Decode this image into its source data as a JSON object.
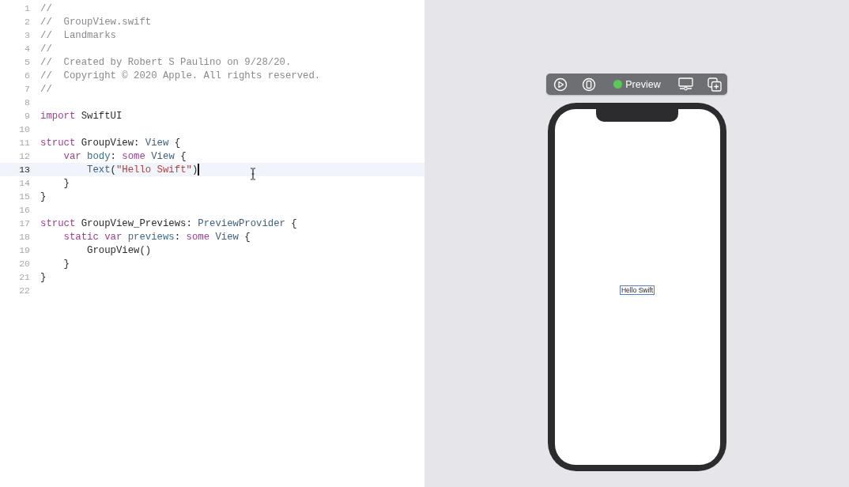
{
  "editor": {
    "lines": [
      {
        "number": "1",
        "selected": false,
        "tokens": [
          {
            "kind": "comment",
            "text": "//"
          }
        ]
      },
      {
        "number": "2",
        "selected": false,
        "tokens": [
          {
            "kind": "comment",
            "text": "//  GroupView.swift"
          }
        ]
      },
      {
        "number": "3",
        "selected": false,
        "tokens": [
          {
            "kind": "comment",
            "text": "//  Landmarks"
          }
        ]
      },
      {
        "number": "4",
        "selected": false,
        "tokens": [
          {
            "kind": "comment",
            "text": "//"
          }
        ]
      },
      {
        "number": "5",
        "selected": false,
        "tokens": [
          {
            "kind": "comment",
            "text": "//  Created by Robert S Paulino on 9/28/20."
          }
        ]
      },
      {
        "number": "6",
        "selected": false,
        "tokens": [
          {
            "kind": "comment",
            "text": "//  Copyright © 2020 Apple. All rights reserved."
          }
        ]
      },
      {
        "number": "7",
        "selected": false,
        "tokens": [
          {
            "kind": "comment",
            "text": "//"
          }
        ]
      },
      {
        "number": "8",
        "selected": false
      },
      {
        "number": "9",
        "selected": false,
        "tokens": [
          {
            "kind": "keyword",
            "text": "import"
          },
          {
            "kind": "plain",
            "text": " SwiftUI"
          }
        ]
      },
      {
        "number": "10",
        "selected": false
      },
      {
        "number": "11",
        "selected": false,
        "tokens": [
          {
            "kind": "keyword",
            "text": "struct"
          },
          {
            "kind": "plain",
            "text": " GroupView: "
          },
          {
            "kind": "type",
            "text": "View"
          },
          {
            "kind": "plain",
            "text": " {"
          }
        ]
      },
      {
        "number": "12",
        "selected": false,
        "tokens": [
          {
            "kind": "keyword",
            "text": "    var"
          },
          {
            "kind": "property",
            "text": " body"
          },
          {
            "kind": "plain",
            "text": ": "
          },
          {
            "kind": "keyword",
            "text": "some"
          },
          {
            "kind": "type",
            "text": " View"
          },
          {
            "kind": "plain",
            "text": " {"
          }
        ]
      },
      {
        "number": "13",
        "selected": true,
        "tokens": [
          {
            "kind": "type",
            "text": "        Text"
          },
          {
            "kind": "plain",
            "text": "("
          },
          {
            "kind": "string",
            "text": "\"Hello Swift\""
          },
          {
            "kind": "plain",
            "text": ")"
          }
        ]
      },
      {
        "number": "14",
        "selected": false,
        "tokens": [
          {
            "kind": "plain",
            "text": "    }"
          }
        ]
      },
      {
        "number": "15",
        "selected": false,
        "tokens": [
          {
            "kind": "plain",
            "text": "}"
          }
        ]
      },
      {
        "number": "16",
        "selected": false
      },
      {
        "number": "17",
        "selected": false,
        "tokens": [
          {
            "kind": "keyword",
            "text": "struct"
          },
          {
            "kind": "plain",
            "text": " GroupView_Previews: "
          },
          {
            "kind": "type",
            "text": "PreviewProvider"
          },
          {
            "kind": "plain",
            "text": " {"
          }
        ]
      },
      {
        "number": "18",
        "selected": false,
        "tokens": [
          {
            "kind": "keyword",
            "text": "    static var"
          },
          {
            "kind": "property",
            "text": " previews"
          },
          {
            "kind": "plain",
            "text": ": "
          },
          {
            "kind": "keyword",
            "text": "some"
          },
          {
            "kind": "type",
            "text": " View"
          },
          {
            "kind": "plain",
            "text": " {"
          }
        ]
      },
      {
        "number": "19",
        "selected": false,
        "tokens": [
          {
            "kind": "plain",
            "text": "        GroupView()"
          }
        ]
      },
      {
        "number": "20",
        "selected": false,
        "tokens": [
          {
            "kind": "plain",
            "text": "    }"
          }
        ]
      },
      {
        "number": "21",
        "selected": false,
        "tokens": [
          {
            "kind": "plain",
            "text": "}"
          }
        ]
      },
      {
        "number": "22",
        "selected": false
      }
    ]
  },
  "preview": {
    "toolbar": {
      "status": {
        "label": "Preview",
        "on": true
      }
    },
    "canvas": {
      "text": "Hello Swift",
      "selected": true
    }
  }
}
